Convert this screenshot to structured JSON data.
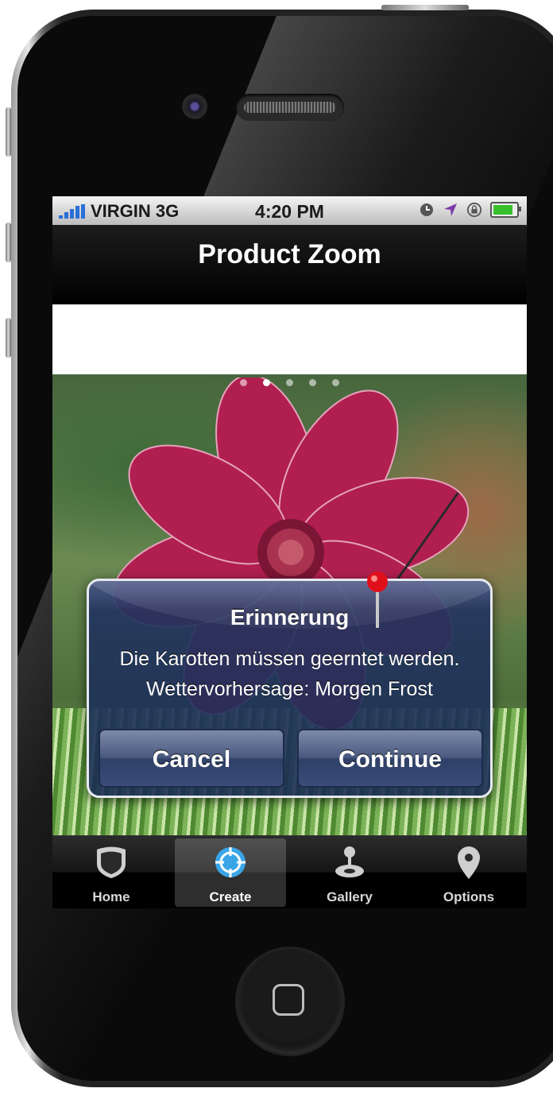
{
  "status_bar": {
    "carrier": "VIRGIN",
    "network": "3G",
    "time": "4:20 PM",
    "icons": [
      "signal-bars-icon",
      "clock-icon",
      "location-arrow-icon",
      "rotation-lock-icon",
      "battery-icon"
    ]
  },
  "nav": {
    "title": "Product Zoom"
  },
  "carousel": {
    "page_count": 5,
    "current_page": 2
  },
  "alert": {
    "title": "Erinnerung",
    "message_line1": "Die Karotten müssen geerntet werden.",
    "message_line2": "Wettervorhersage: Morgen Frost",
    "cancel_label": "Cancel",
    "continue_label": "Continue",
    "pin_icon": "map-pin-icon"
  },
  "tabs": [
    {
      "label": "Home",
      "icon": "shield-icon",
      "active": false
    },
    {
      "label": "Create",
      "icon": "crosshair-icon",
      "active": true
    },
    {
      "label": "Gallery",
      "icon": "joystick-icon",
      "active": false
    },
    {
      "label": "Options",
      "icon": "location-pin-icon",
      "active": false
    }
  ],
  "colors": {
    "accent_blue": "#3aa6e8",
    "alert_bg": "#22345e",
    "signal_blue": "#2a6fd8",
    "battery_green": "#37c02b",
    "flower_pink": "#b01f4f"
  }
}
